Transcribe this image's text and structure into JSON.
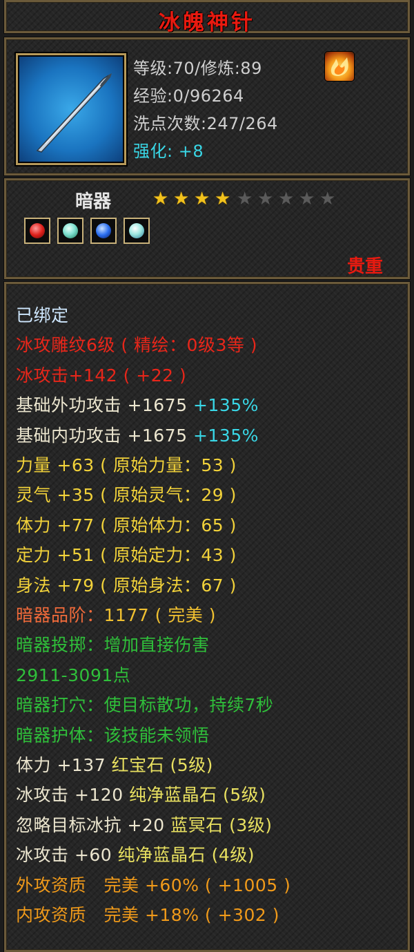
{
  "title": "冰魄神针",
  "info": {
    "level_line": "等级:70/修炼:89",
    "exp_line": "经验:0/96264",
    "wash_line": "洗点次数:247/264",
    "strengthen_label": "强化:",
    "strengthen_value": "+8"
  },
  "type_panel": {
    "type_label": "暗器",
    "stars_filled": 4,
    "stars_total": 9,
    "rarity": "贵重"
  },
  "gems": [
    {
      "name": "red-gem",
      "color": "#e0201a"
    },
    {
      "name": "cyan-gem",
      "color": "#7fe0d0"
    },
    {
      "name": "blue-gem",
      "color": "#2a6ef0"
    },
    {
      "name": "cyan-gem",
      "color": "#9ee8e0"
    }
  ],
  "stats": [
    {
      "segments": [
        {
          "text": "已绑定",
          "color": "lightblue"
        }
      ]
    },
    {
      "segments": [
        {
          "text": "冰攻雕纹6级 ( 精绘：0级3等 )",
          "color": "red"
        }
      ]
    },
    {
      "segments": [
        {
          "text": "冰攻击+142 ( +22 )",
          "color": "red"
        }
      ]
    },
    {
      "segments": [
        {
          "text": "基础外功攻击 +1675 ",
          "color": "cream"
        },
        {
          "text": "+135%",
          "color": "cyan"
        }
      ]
    },
    {
      "segments": [
        {
          "text": "基础内功攻击 +1675 ",
          "color": "cream"
        },
        {
          "text": "+135%",
          "color": "cyan"
        }
      ]
    },
    {
      "segments": [
        {
          "text": "力量 +63 ( 原始力量：53 )",
          "color": "yellow"
        }
      ]
    },
    {
      "segments": [
        {
          "text": "灵气 +35 ( 原始灵气：29 )",
          "color": "yellow"
        }
      ]
    },
    {
      "segments": [
        {
          "text": "体力 +77 ( 原始体力：65 )",
          "color": "yellow"
        }
      ]
    },
    {
      "segments": [
        {
          "text": "定力 +51 ( 原始定力：43 )",
          "color": "yellow"
        }
      ]
    },
    {
      "segments": [
        {
          "text": "身法 +79 ( 原始身法：67 )",
          "color": "yellow"
        }
      ]
    },
    {
      "segments": [
        {
          "text": "暗器品阶：",
          "color": "orangered"
        },
        {
          "text": "1177 ( 完美 )",
          "color": "gold"
        }
      ]
    },
    {
      "segments": [
        {
          "text": "暗器投掷：增加直接伤害",
          "color": "green"
        }
      ]
    },
    {
      "segments": [
        {
          "text": "2911-3091点",
          "color": "green"
        }
      ]
    },
    {
      "segments": [
        {
          "text": "暗器打穴：使目标散功，持续7秒",
          "color": "green"
        }
      ]
    },
    {
      "segments": [
        {
          "text": "暗器护体：该技能未领悟",
          "color": "green"
        }
      ]
    },
    {
      "segments": [
        {
          "text": "体力 +137 ",
          "color": "cream"
        },
        {
          "text": "红宝石 (5级)",
          "color": "yellowgreen"
        }
      ]
    },
    {
      "segments": [
        {
          "text": "冰攻击 +120 ",
          "color": "cream"
        },
        {
          "text": "纯净蓝晶石 (5级)",
          "color": "yellowgreen"
        }
      ]
    },
    {
      "segments": [
        {
          "text": "忽略目标冰抗 +20 ",
          "color": "cream"
        },
        {
          "text": "蓝冥石 (3级)",
          "color": "yellowgreen"
        }
      ]
    },
    {
      "segments": [
        {
          "text": "冰攻击 +60 ",
          "color": "cream"
        },
        {
          "text": "纯净蓝晶石 (4级)",
          "color": "yellowgreen"
        }
      ]
    },
    {
      "segments": [
        {
          "text": "外攻资质　完美 +60% ( +1005 )",
          "color": "orange"
        }
      ]
    },
    {
      "segments": [
        {
          "text": "内攻资质　完美 +18% ( +302 )",
          "color": "orange"
        }
      ]
    }
  ]
}
